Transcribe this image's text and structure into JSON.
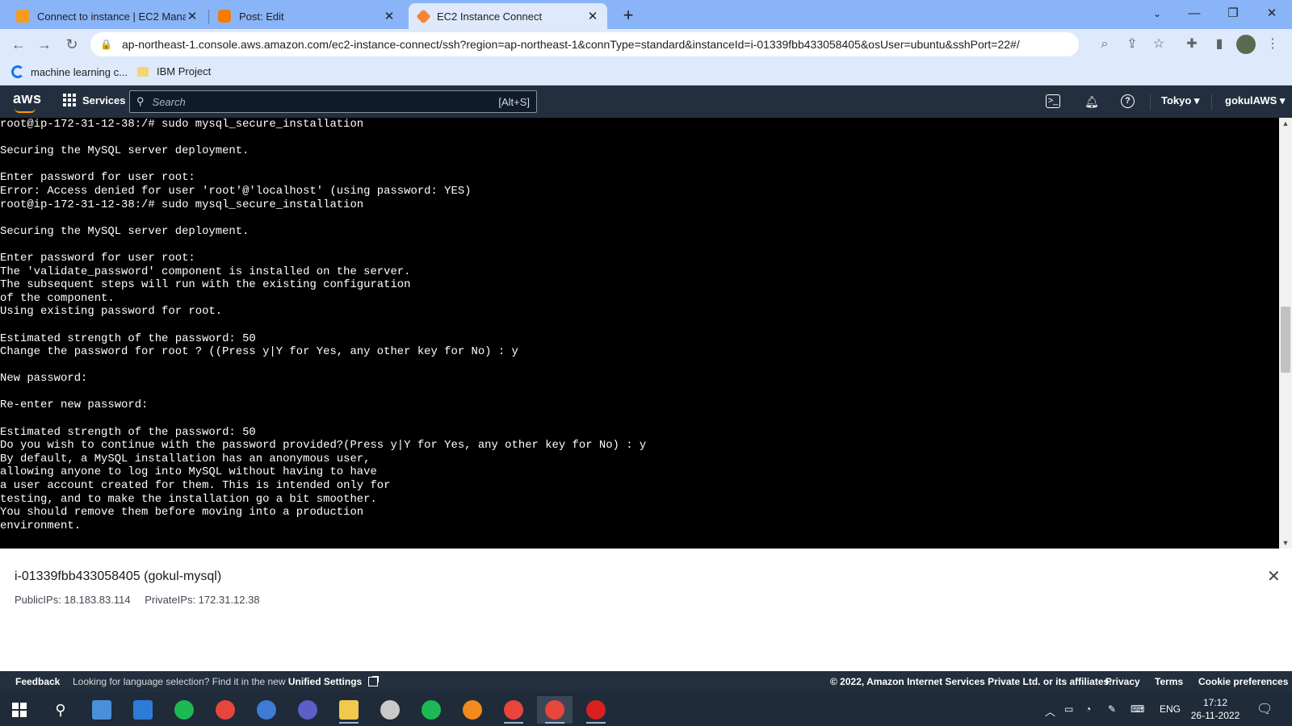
{
  "browser": {
    "tabs": [
      {
        "title": "Connect to instance | EC2 Manag",
        "favicon_color": "#f29d1e",
        "active": false
      },
      {
        "title": "Post: Edit",
        "favicon_color": "#f57c00",
        "active": false
      },
      {
        "title": "EC2 Instance Connect",
        "favicon_color": "#f58536",
        "active": true
      }
    ],
    "new_tab_label": "+",
    "url": "ap-northeast-1.console.aws.amazon.com/ec2-instance-connect/ssh?region=ap-northeast-1&connType=standard&instanceId=i-01339fbb433058405&osUser=ubuntu&sshPort=22#/",
    "bookmarks": [
      {
        "label": "machine learning c...",
        "icon": "c-logo-icon"
      },
      {
        "label": "IBM Project",
        "icon": "folder-icon"
      }
    ]
  },
  "aws_header": {
    "logo": "aws",
    "services_label": "Services",
    "search_placeholder": "Search",
    "search_shortcut": "[Alt+S]",
    "region": "Tokyo ▾",
    "account": "gokulAWS ▾"
  },
  "terminal": {
    "lines": [
      "root@ip-172-31-12-38:/# sudo mysql_secure_installation",
      "",
      "Securing the MySQL server deployment.",
      "",
      "Enter password for user root:",
      "Error: Access denied for user 'root'@'localhost' (using password: YES)",
      "root@ip-172-31-12-38:/# sudo mysql_secure_installation",
      "",
      "Securing the MySQL server deployment.",
      "",
      "Enter password for user root:",
      "The 'validate_password' component is installed on the server.",
      "The subsequent steps will run with the existing configuration",
      "of the component.",
      "Using existing password for root.",
      "",
      "Estimated strength of the password: 50",
      "Change the password for root ? ((Press y|Y for Yes, any other key for No) : y",
      "",
      "New password:",
      "",
      "Re-enter new password:",
      "",
      "Estimated strength of the password: 50",
      "Do you wish to continue with the password provided?(Press y|Y for Yes, any other key for No) : y",
      "By default, a MySQL installation has an anonymous user,",
      "allowing anyone to log into MySQL without having to have",
      "a user account created for them. This is intended only for",
      "testing, and to make the installation go a bit smoother.",
      "You should remove them before moving into a production",
      "environment."
    ]
  },
  "instance_panel": {
    "title": "i-01339fbb433058405 (gokul-mysql)",
    "public_ips": "PublicIPs: 18.183.83.114",
    "private_ips": "PrivateIPs: 172.31.12.38"
  },
  "footer": {
    "feedback": "Feedback",
    "language_text": "Looking for language selection? Find it in the new",
    "unified_settings": "Unified Settings",
    "copyright": "© 2022, Amazon Internet Services Private Ltd. or its affiliates.",
    "privacy": "Privacy",
    "terms": "Terms",
    "cookies": "Cookie preferences"
  },
  "taskbar": {
    "apps": [
      {
        "name": "file-explorer-window-icon",
        "color": "#4a90d9"
      },
      {
        "name": "mail-icon",
        "color": "#2d7bd6"
      },
      {
        "name": "spotify-icon",
        "color": "#1db954"
      },
      {
        "name": "chrome-icon",
        "color": "#e8453c"
      },
      {
        "name": "qbittorrent-icon",
        "color": "#3f7ad6"
      },
      {
        "name": "teams-icon",
        "color": "#5b5fc7"
      },
      {
        "name": "folder-icon",
        "color": "#f2c94c"
      },
      {
        "name": "media-player-icon",
        "color": "#c9c9c9"
      },
      {
        "name": "spotify-icon-2",
        "color": "#1db954"
      },
      {
        "name": "vlc-icon",
        "color": "#f28a1e"
      },
      {
        "name": "chrome-profile-icon",
        "color": "#e8453c"
      },
      {
        "name": "chrome-profile-2-icon",
        "color": "#e8453c"
      },
      {
        "name": "acrobat-icon",
        "color": "#d9201f"
      }
    ],
    "language": "ENG",
    "time": "17:12",
    "date": "26-11-2022"
  }
}
